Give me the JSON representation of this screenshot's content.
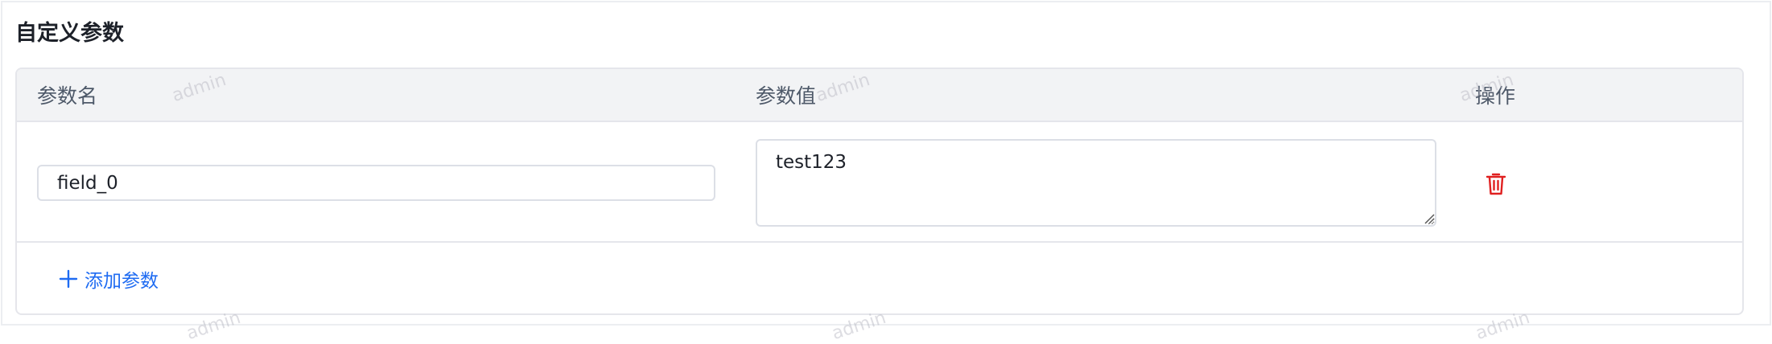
{
  "section": {
    "title": "自定义参数"
  },
  "table": {
    "columns": {
      "name": "参数名",
      "value": "参数值",
      "action": "操作"
    },
    "rows": [
      {
        "name": "field_0",
        "value": "test123"
      }
    ]
  },
  "actions": {
    "add_label": "添加参数"
  },
  "watermark": {
    "text": "admin"
  },
  "colors": {
    "accent": "#1e6bf2",
    "danger": "#e02020",
    "header_bg": "#f2f3f5"
  },
  "icons": {
    "delete": "trash-icon",
    "add": "plus-icon",
    "resize": "resize-grip-icon"
  }
}
